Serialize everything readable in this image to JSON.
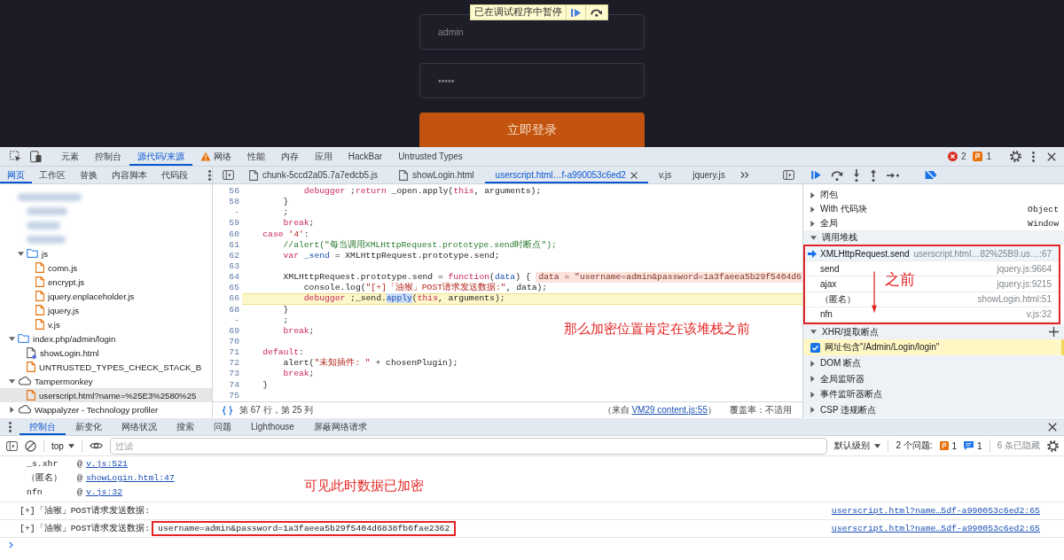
{
  "page": {
    "username": "admin",
    "password": "•••••",
    "login_button": "立即登录",
    "paused_banner": "已在调试程序中暂停"
  },
  "main_tabs": [
    {
      "label": "元素",
      "selected": false,
      "warning": false
    },
    {
      "label": "控制台",
      "selected": false,
      "warning": false
    },
    {
      "label": "源代码/来源",
      "selected": true,
      "warning": false
    },
    {
      "label": "网络",
      "selected": false,
      "warning": true
    },
    {
      "label": "性能",
      "selected": false,
      "warning": false
    },
    {
      "label": "内存",
      "selected": false,
      "warning": false
    },
    {
      "label": "应用",
      "selected": false,
      "warning": false
    },
    {
      "label": "HackBar",
      "selected": false,
      "warning": false
    },
    {
      "label": "Untrusted Types",
      "selected": false,
      "warning": false
    }
  ],
  "toolbar_counts": {
    "errors": "2",
    "warnings": "1"
  },
  "navigator_tabs": [
    {
      "label": "网页",
      "selected": true
    },
    {
      "label": "工作区",
      "selected": false
    },
    {
      "label": "替换",
      "selected": false
    },
    {
      "label": "内容脚本",
      "selected": false
    },
    {
      "label": "代码段",
      "selected": false
    }
  ],
  "file_tree": [
    {
      "kind": "redacted",
      "children": [
        {
          "kind": "redacted"
        },
        {
          "kind": "redacted"
        },
        {
          "kind": "redacted"
        },
        {
          "kind": "folder",
          "label": "js",
          "expanded": true,
          "selected": false,
          "children": [
            {
              "kind": "script",
              "label": "comn.js",
              "selected": false
            },
            {
              "kind": "script",
              "label": "encrypt.js",
              "selected": false
            },
            {
              "kind": "script",
              "label": "jquery.enplaceholder.js",
              "selected": false
            },
            {
              "kind": "script",
              "label": "jquery.js",
              "selected": false
            },
            {
              "kind": "script",
              "label": "v.js",
              "selected": false
            }
          ]
        }
      ]
    },
    {
      "kind": "folder",
      "label": "index.php/admin/login",
      "expanded": true,
      "selected": false,
      "children": [
        {
          "kind": "page",
          "label": "showLogin.html",
          "selected": false
        },
        {
          "kind": "script",
          "label": "UNTRUSTED_TYPES_CHECK_STACK_B",
          "selected": false
        }
      ]
    },
    {
      "kind": "extension",
      "label": "Tampermonkey",
      "expanded": true,
      "selected": false,
      "children": [
        {
          "kind": "script",
          "label": "userscript.html?name=%25E3%2580%25",
          "selected": true
        }
      ]
    },
    {
      "kind": "extension",
      "label": "Wappalyzer - Technology profiler",
      "expanded": false,
      "selected": false
    }
  ],
  "editor_tabs": [
    {
      "label": "chunk-5ccd2a05.7a7edcb5.js",
      "kind": "file",
      "selected": false,
      "closable": false
    },
    {
      "label": "showLogin.html",
      "kind": "file",
      "selected": false,
      "closable": false
    },
    {
      "label": "userscript.html…f-a990053c6ed2",
      "kind": "plain",
      "selected": true,
      "closable": true
    },
    {
      "label": "v.js",
      "kind": "plain",
      "selected": false,
      "closable": false
    },
    {
      "label": "jquery.js",
      "kind": "plain",
      "selected": false,
      "closable": false
    }
  ],
  "code_lines": [
    {
      "number": "56",
      "paused": false,
      "tokens": [
        {
          "kind": "keyword",
          "text": "            debugger"
        },
        {
          "kind": "plain",
          "text": " ;"
        },
        {
          "kind": "keyword",
          "text": "return"
        },
        {
          "kind": "plain",
          "text": " _open.apply("
        },
        {
          "kind": "keyword",
          "text": "this"
        },
        {
          "kind": "plain",
          "text": ", arguments);"
        }
      ]
    },
    {
      "number": "58",
      "paused": false,
      "tokens": [
        {
          "kind": "plain",
          "text": "        }"
        }
      ]
    },
    {
      "number": "-",
      "paused": false,
      "tokens": [
        {
          "kind": "plain",
          "text": "        ;"
        }
      ]
    },
    {
      "number": "59",
      "paused": false,
      "tokens": [
        {
          "kind": "keyword",
          "text": "        break"
        },
        {
          "kind": "plain",
          "text": ";"
        }
      ]
    },
    {
      "number": "60",
      "paused": false,
      "tokens": [
        {
          "kind": "keyword",
          "text": "    case "
        },
        {
          "kind": "string",
          "text": "'4'"
        },
        {
          "kind": "plain",
          "text": ":"
        }
      ]
    },
    {
      "number": "61",
      "paused": false,
      "tokens": [
        {
          "kind": "comment",
          "text": "        //alert(\"每当调用XMLHttpRequest.prototype.send时断点\");"
        }
      ]
    },
    {
      "number": "62",
      "paused": false,
      "tokens": [
        {
          "kind": "keyword",
          "text": "        var "
        },
        {
          "kind": "variable",
          "text": "_send"
        },
        {
          "kind": "plain",
          "text": " = XMLHttpRequest.prototype.send;"
        }
      ]
    },
    {
      "number": "63",
      "paused": false
    },
    {
      "number": "64",
      "paused": false,
      "tokens": [
        {
          "kind": "plain",
          "text": "        XMLHttpRequest.prototype.send = "
        },
        {
          "kind": "keyword",
          "text": "function"
        },
        {
          "kind": "plain",
          "text": "("
        },
        {
          "kind": "variable",
          "text": "data"
        },
        {
          "kind": "plain",
          "text": ") {"
        }
      ],
      "inline_value": "data = \"username=admin&password=1a3faeea5b29f5404d6"
    },
    {
      "number": "65",
      "paused": false,
      "tokens": [
        {
          "kind": "plain",
          "text": "            console.log("
        },
        {
          "kind": "string",
          "text": "\"[+]「油猴」POST请求发送数据:\""
        },
        {
          "kind": "plain",
          "text": ", data);"
        }
      ]
    },
    {
      "number": "66",
      "paused": true,
      "tokens": [
        {
          "kind": "keyword",
          "text": "            debugger"
        },
        {
          "kind": "plain",
          "text": " ;_send."
        },
        {
          "kind": "match",
          "text": "apply"
        },
        {
          "kind": "plain",
          "text": "("
        },
        {
          "kind": "keyword",
          "text": "this"
        },
        {
          "kind": "plain",
          "text": ", arguments);"
        }
      ]
    },
    {
      "number": "68",
      "paused": false,
      "tokens": [
        {
          "kind": "plain",
          "text": "        }"
        }
      ]
    },
    {
      "number": "-",
      "paused": false,
      "tokens": [
        {
          "kind": "plain",
          "text": "        ;"
        }
      ]
    },
    {
      "number": "69",
      "paused": false,
      "tokens": [
        {
          "kind": "keyword",
          "text": "        break"
        },
        {
          "kind": "plain",
          "text": ";"
        }
      ]
    },
    {
      "number": "70",
      "paused": false
    },
    {
      "number": "71",
      "paused": false,
      "tokens": [
        {
          "kind": "keyword",
          "text": "    default"
        },
        {
          "kind": "plain",
          "text": ":"
        }
      ]
    },
    {
      "number": "72",
      "paused": false,
      "tokens": [
        {
          "kind": "plain",
          "text": "        alert("
        },
        {
          "kind": "string",
          "text": "\"未知插件: \""
        },
        {
          "kind": "plain",
          "text": " + chosenPlugin);"
        }
      ]
    },
    {
      "number": "73",
      "paused": false,
      "tokens": [
        {
          "kind": "keyword",
          "text": "        break"
        },
        {
          "kind": "plain",
          "text": ";"
        }
      ]
    },
    {
      "number": "74",
      "paused": false,
      "tokens": [
        {
          "kind": "plain",
          "text": "    }"
        }
      ]
    },
    {
      "number": "75",
      "paused": false
    }
  ],
  "code_annotation": "那么加密位置肯定在该堆栈之前",
  "editor_status": {
    "cursor": "第 67 行，第 25 列",
    "source_prefix": "（来自 ",
    "source_link": "VM29 content.js:55",
    "source_suffix": "）",
    "coverage": "覆盖率：不适用"
  },
  "scope": [
    {
      "label": "闭包",
      "expanded": false
    },
    {
      "label": "With 代码块",
      "value": "Object",
      "expanded": false
    },
    {
      "label": "全局",
      "value": "Window",
      "expanded": false
    }
  ],
  "call_stack": {
    "label": "调用堆栈",
    "expanded": true,
    "boxed": true,
    "frames": [
      {
        "name": "XMLHttpRequest.send",
        "location": "userscript.html…82%25B9.us…:67",
        "selected": true
      },
      {
        "name": "send",
        "location": "jquery.js:9664",
        "selected": false
      },
      {
        "name": "ajax",
        "location": "jquery.js:9215",
        "selected": false
      },
      {
        "name": "（匿名）",
        "location": "showLogin.html:51",
        "selected": false
      },
      {
        "name": "nfn",
        "location": "v.js:32",
        "selected": false
      }
    ],
    "annotation": "之前"
  },
  "xhr_breakpoints": {
    "label": "XHR/提取断点",
    "expanded": true,
    "items": [
      {
        "label": "网址包含\"/Admin/Login/login\"",
        "checked": true,
        "hit": true
      }
    ]
  },
  "breakpoint_sections": [
    {
      "label": "DOM 断点",
      "expanded": false
    },
    {
      "label": "全局监听器",
      "expanded": false
    },
    {
      "label": "事件监听器断点",
      "expanded": false
    },
    {
      "label": "CSP 违规断点",
      "expanded": false
    }
  ],
  "drawer_tabs": [
    {
      "label": "控制台",
      "selected": true
    },
    {
      "label": "新变化",
      "selected": false
    },
    {
      "label": "网络状况",
      "selected": false
    },
    {
      "label": "搜索",
      "selected": false
    },
    {
      "label": "问题",
      "selected": false
    },
    {
      "label": "Lighthouse",
      "selected": false
    },
    {
      "label": "屏蔽网络请求",
      "selected": false
    }
  ],
  "console_toolbar": {
    "context": "top",
    "filter_placeholder": "过滤",
    "level": "默认级别",
    "issues_label": "2 个问题:",
    "issue_warnings": "1",
    "issue_info": "1",
    "hidden": "6 条已隐藏"
  },
  "console_messages": [
    {
      "kind": "stack",
      "name": "_s.xhr",
      "at": "@",
      "link": "v.js:521"
    },
    {
      "kind": "stack",
      "name": "（匿名）",
      "at": "@",
      "link": "showLogin.html:47"
    },
    {
      "kind": "stack",
      "name": "nfn",
      "at": "@",
      "link": "v.js:32"
    },
    {
      "kind": "log",
      "text": "[+]「油猴」POST请求发送数据:",
      "source": "userscript.html?name…5df-a990053c6ed2:65"
    },
    {
      "kind": "log",
      "text": "[+]「油猴」POST请求发送数据:",
      "value": "username=admin&password=1a3faeea5b29f5404d6838fb6fae2362",
      "boxed": true,
      "source": "userscript.html?name…5df-a990053c6ed2:65"
    }
  ],
  "console_annotation": "可见此时数据已加密"
}
